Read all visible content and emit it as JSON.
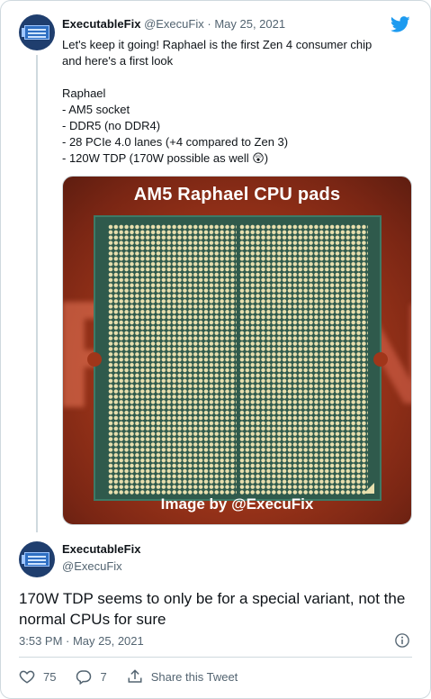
{
  "tweet1": {
    "display_name": "ExecutableFix",
    "handle": "@ExecuFix",
    "separator": "·",
    "date": "May 25, 2021",
    "body": "Let's keep it going! Raphael is the first Zen 4 consumer chip\nand here's a first look\n\nRaphael\n - AM5 socket\n - DDR5 (no DDR4)\n - 28 PCIe 4.0 lanes (+4 compared to Zen 3)\n - 120W TDP (170W possible as well 😲)",
    "image": {
      "title": "AM5 Raphael CPU pads",
      "credit": "Image by @ExecuFix"
    }
  },
  "tweet2": {
    "display_name": "ExecutableFix",
    "handle": "@ExecuFix",
    "text": "170W TDP seems to only be for a special variant, not the normal CPUs for sure",
    "timestamp": "3:53 PM · May 25, 2021"
  },
  "actions": {
    "likes": "75",
    "replies": "7",
    "share_label": "Share this Tweet"
  },
  "icons": {
    "brand": "twitter-bird-icon",
    "info": "info-icon",
    "like": "heart-icon",
    "reply": "reply-bubble-icon",
    "share": "share-icon"
  },
  "colors": {
    "brand": "#1d9bf0",
    "muted": "#536471",
    "text": "#0f1419"
  }
}
